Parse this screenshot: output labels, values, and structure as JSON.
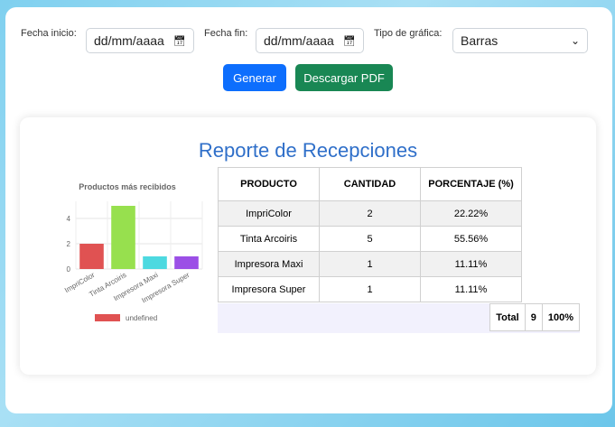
{
  "filters": {
    "start_label": "Fecha inicio:",
    "start_value": "dd/mm/aaaa",
    "end_label": "Fecha fin:",
    "end_value": "dd/mm/aaaa",
    "type_label": "Tipo de gráfica:",
    "type_value": "Barras",
    "calendar_icon": "calendar-icon",
    "dropdown_icon": "chevron-down-icon"
  },
  "buttons": {
    "generate": "Generar",
    "download": "Descargar PDF"
  },
  "colors": {
    "generate": "#0d6efd",
    "download": "#198754",
    "title": "#2f6fc9"
  },
  "report": {
    "title": "Reporte de Recepciones",
    "table": {
      "headers": [
        "PRODUCTO",
        "CANTIDAD",
        "PORCENTAJE (%)"
      ],
      "rows": [
        [
          "ImpriColor",
          "2",
          "22.22%"
        ],
        [
          "Tinta Arcoiris",
          "5",
          "55.56%"
        ],
        [
          "Impresora Maxi",
          "1",
          "11.11%"
        ],
        [
          "Impresora Super",
          "1",
          "11.11%"
        ]
      ],
      "total_label": "Total",
      "total_count": "9",
      "total_percent": "100%"
    }
  },
  "chart_data": {
    "type": "bar",
    "title": "Productos más recibidos",
    "categories": [
      "ImpriColor",
      "Tinta Arcoiris",
      "Impresora Maxi",
      "Impresora Super"
    ],
    "values": [
      2,
      5,
      1,
      1
    ],
    "colors": [
      "#e05252",
      "#97e04e",
      "#4dd9e0",
      "#9b4fe6"
    ],
    "yticks": [
      "0",
      "2",
      "4"
    ],
    "ylim": [
      0,
      5
    ],
    "legend": {
      "label": "undefined",
      "color": "#e05252",
      "position": "bottom"
    },
    "grid": true
  }
}
